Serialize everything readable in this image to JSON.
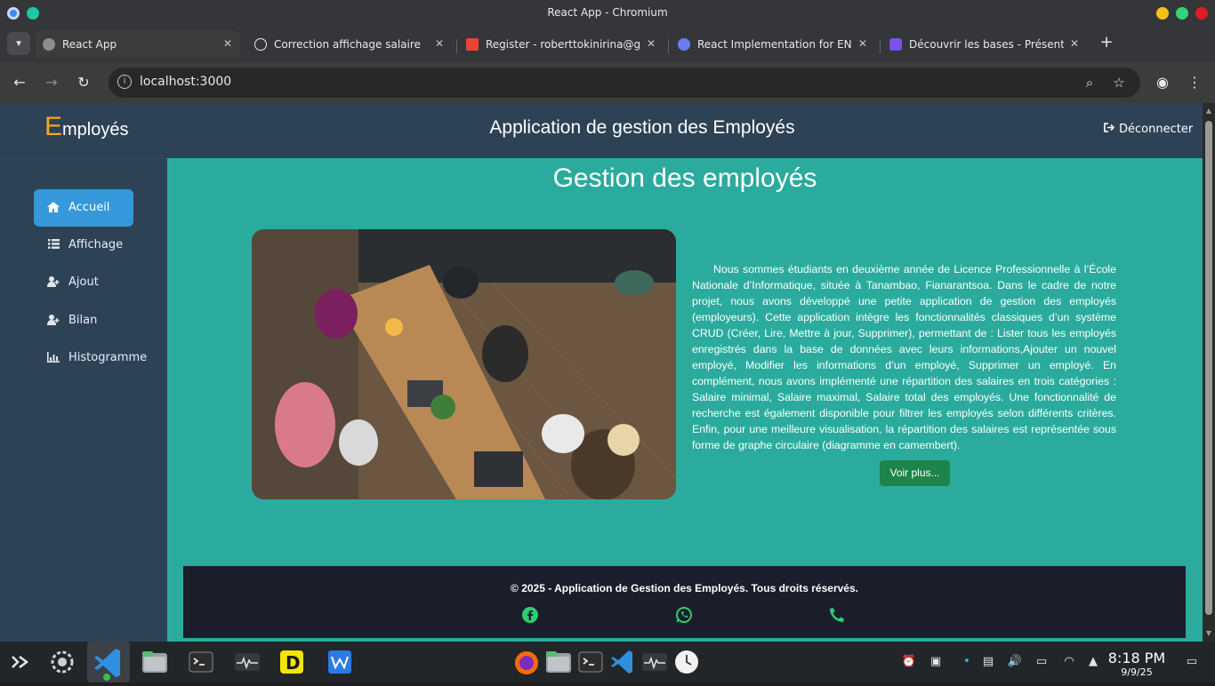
{
  "window": {
    "title": "React App - Chromium"
  },
  "tabs": [
    {
      "label": "React App",
      "favicon": "globe-icon"
    },
    {
      "label": "Correction affichage salaire",
      "favicon": "chatgpt-icon"
    },
    {
      "label": "Register - roberttokinirina@gma",
      "favicon": "gmail-icon"
    },
    {
      "label": "React Implementation for ENI A",
      "favicon": "claude-icon"
    },
    {
      "label": "Découvrir les bases - Présentatio",
      "favicon": "app-icon"
    }
  ],
  "toolbar": {
    "url": "localhost:3000"
  },
  "app": {
    "brand_first": "E",
    "brand_rest": "mployés",
    "title": "Application de gestion des Employés",
    "logout_label": "Déconnecter",
    "accent": "#f5a623"
  },
  "sidebar": {
    "items": [
      {
        "label": "Accueil",
        "icon": "home-icon",
        "active": true
      },
      {
        "label": "Affichage",
        "icon": "list-icon",
        "active": false
      },
      {
        "label": "Ajout",
        "icon": "user-plus-icon",
        "active": false
      },
      {
        "label": "Bilan",
        "icon": "user-plus-icon",
        "active": false
      },
      {
        "label": "Histogramme",
        "icon": "bar-chart-icon",
        "active": false
      }
    ]
  },
  "main": {
    "title": "Gestion des employés",
    "description": "Nous sommes étudiants en deuxième année de Licence Professionnelle à l’École Nationale d’Informatique, située à Tanambao, Fianarantsoa. Dans le cadre de notre projet, nous avons développé une petite application de gestion des employés (employeurs). Cette application intègre les fonctionnalités classiques d’un système CRUD (Créer, Lire, Mettre à jour, Supprimer), permettant de : Lister tous les employés enregistrés dans la base de données avec leurs informations,Ajouter un nouvel employé, Modifier les informations d’un employé, Supprimer un employé. En complément, nous avons implémenté une répartition des salaires en trois catégories : Salaire minimal, Salaire maximal, Salaire total des employés. Une fonctionnalité de recherche est également disponible pour filtrer les employés selon différents critères. Enfin, pour une meilleure visualisation, la répartition des salaires est représentée sous forme de graphe circulaire (diagramme en camembert).",
    "more_label": "Voir plus..."
  },
  "footer": {
    "copyright": "© 2025 - Application de Gestion des Employés. Tous droits réservés.",
    "icons": [
      "facebook-icon",
      "whatsapp-icon",
      "phone-icon"
    ],
    "icon_color": "#2ecc71"
  },
  "taskbar": {
    "time": "8:18 PM",
    "date": "9/9/25"
  }
}
